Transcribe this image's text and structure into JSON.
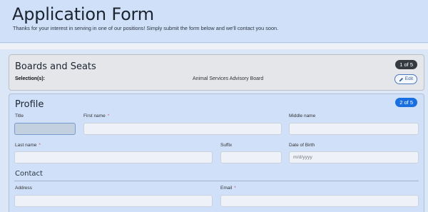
{
  "header": {
    "title": "Application Form",
    "subtitle": "Thanks for your interest in serving in one of our positions! Simply submit the form below and we'll contact you soon."
  },
  "boards": {
    "title": "Boards and Seats",
    "step": "1 of 5",
    "selection_label": "Selection(s):",
    "selection_value": "Animal Services Advisory Board",
    "edit_label": "Edit"
  },
  "profile": {
    "title": "Profile",
    "step": "2 of 5",
    "required_mark": "*",
    "fields": {
      "title": {
        "label": "Title",
        "value": ""
      },
      "first_name": {
        "label": "First name",
        "value": ""
      },
      "middle_name": {
        "label": "Middle name",
        "value": ""
      },
      "last_name": {
        "label": "Last name",
        "value": ""
      },
      "suffix": {
        "label": "Suffix",
        "value": ""
      },
      "dob": {
        "label": "Date of Birth",
        "placeholder": "m/d/yyyy"
      }
    },
    "contact": {
      "title": "Contact",
      "address": {
        "label": "Address",
        "value": ""
      },
      "email": {
        "label": "Email",
        "value": ""
      }
    }
  },
  "colors": {
    "header_bg": "#cfe0f8",
    "step_active": "#1a6fe0",
    "step_done": "#343a40",
    "required": "#d9534f"
  },
  "icons": {
    "edit": "pencil-icon"
  }
}
